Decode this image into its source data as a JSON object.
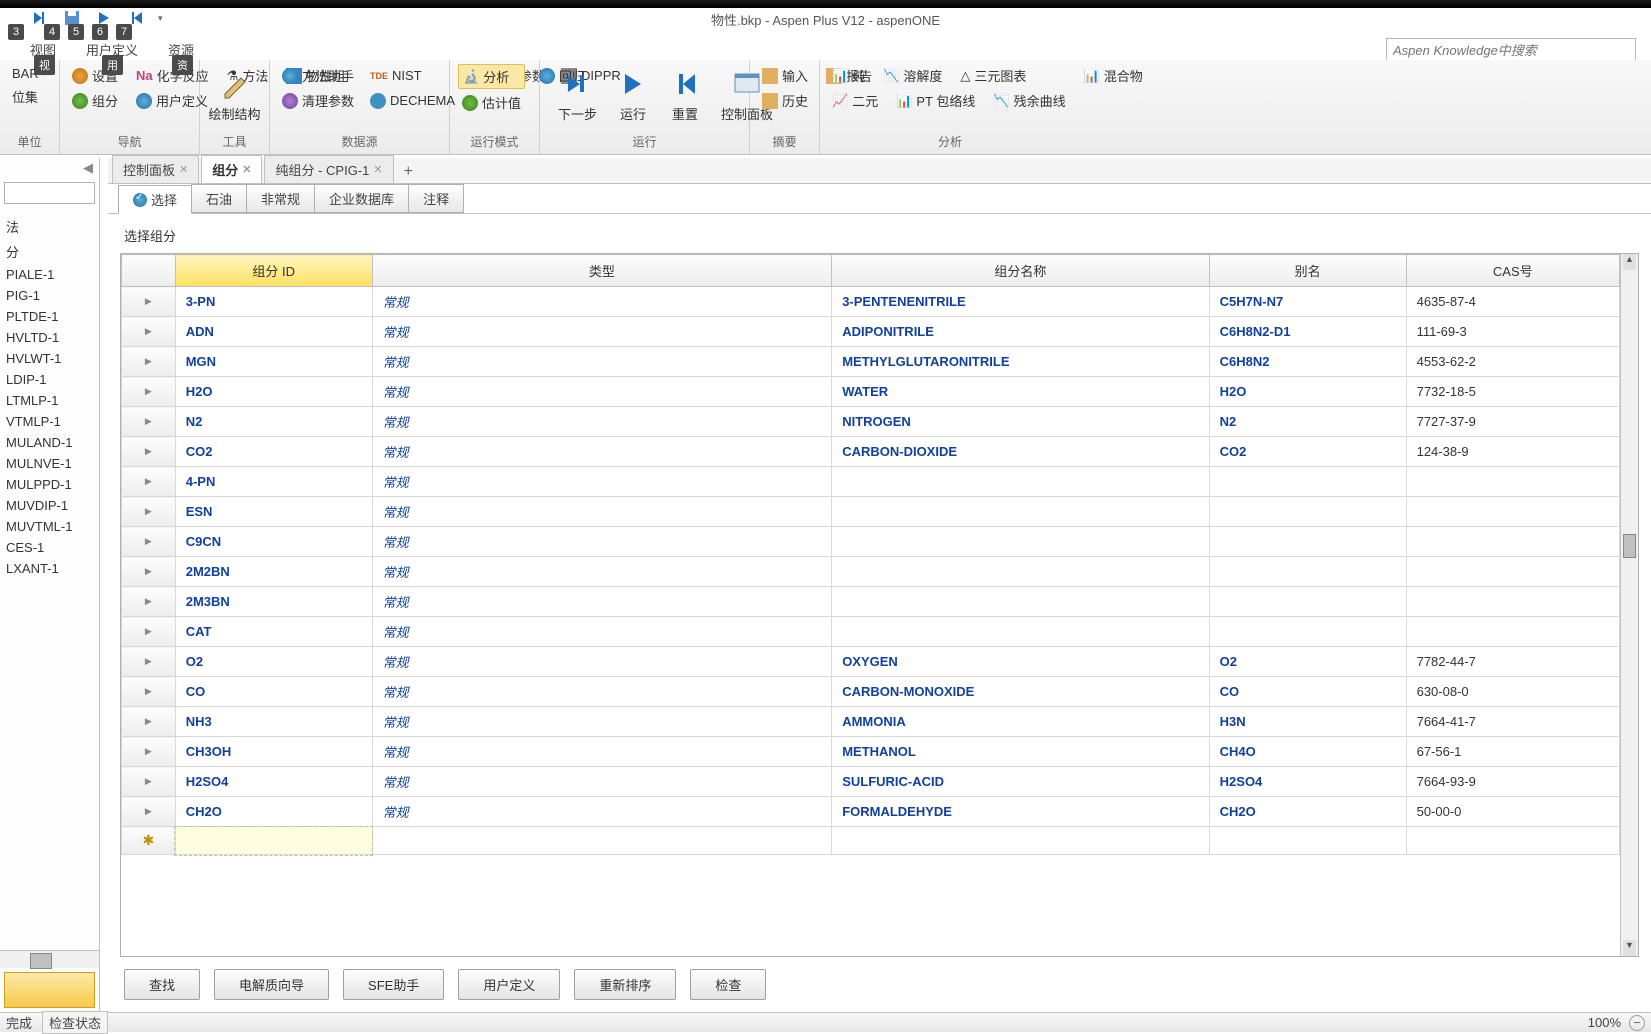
{
  "window": {
    "title": "物性.bkp - Aspen Plus V12 - aspenONE"
  },
  "keytips": [
    "3",
    "4",
    "5",
    "6",
    "7",
    "视",
    "用",
    "资"
  ],
  "menubar": {
    "items": [
      "视图",
      "用户定义",
      "资源"
    ]
  },
  "search": {
    "placeholder": "Aspen Knowledge中搜索"
  },
  "ribbon": {
    "groups": [
      {
        "label": "单位",
        "items": [
          {
            "text": "BAR"
          },
          {
            "text": "位集"
          }
        ]
      },
      {
        "label": "导航",
        "items": [
          {
            "text": "设置"
          },
          {
            "text": "化学反应"
          },
          {
            "text": "组分"
          },
          {
            "text": "用户定义"
          },
          {
            "text": "方法"
          },
          {
            "text": "物性组"
          }
        ]
      },
      {
        "label": "工具",
        "items": [
          {
            "text": "绘制结构",
            "big": true
          }
        ]
      },
      {
        "label": "数据源",
        "items": [
          {
            "text": "方法助手"
          },
          {
            "text": "NIST"
          },
          {
            "text": "清理参数"
          },
          {
            "text": "DECHEMA"
          },
          {
            "text": "检索参数"
          },
          {
            "text": "DIPPR"
          }
        ]
      },
      {
        "label": "运行模式",
        "items": [
          {
            "text": "分析",
            "active": true
          },
          {
            "text": "估计值"
          },
          {
            "text": "回归"
          }
        ]
      },
      {
        "label": "运行",
        "items": [
          {
            "text": "下一步",
            "big": true
          },
          {
            "text": "运行",
            "big": true
          },
          {
            "text": "重置",
            "big": true
          },
          {
            "text": "控制面板",
            "big": true
          }
        ]
      },
      {
        "label": "摘要",
        "items": [
          {
            "text": "输入"
          },
          {
            "text": "历史"
          },
          {
            "text": "报告"
          }
        ]
      },
      {
        "label": "分析",
        "items": [
          {
            "text": "纯"
          },
          {
            "text": "溶解度"
          },
          {
            "text": "三元图表"
          },
          {
            "text": "二元"
          },
          {
            "text": "PT 包络线"
          },
          {
            "text": "残余曲线"
          },
          {
            "text": "混合物"
          }
        ]
      }
    ]
  },
  "left_panel": {
    "tree_items": [
      "法",
      "分",
      "PIALE-1",
      "PIG-1",
      "PLTDE-1",
      "HVLTD-1",
      "HVLWT-1",
      "LDIP-1",
      "LTMLP-1",
      "VTMLP-1",
      "MULAND-1",
      "MULNVE-1",
      "MULPPD-1",
      "MUVDIP-1",
      "MUVTML-1",
      "CES-1",
      "LXANT-1"
    ]
  },
  "doc_tabs": {
    "items": [
      {
        "label": "控制面板",
        "closable": true
      },
      {
        "label": "组分",
        "active": true,
        "closable": true
      },
      {
        "label": "纯组分 - CPIG-1",
        "closable": true
      }
    ],
    "add": "+"
  },
  "inner_tabs": {
    "items": [
      {
        "label": "选择",
        "checked": true,
        "active": true
      },
      {
        "label": "石油"
      },
      {
        "label": "非常规"
      },
      {
        "label": "企业数据库"
      },
      {
        "label": "注释"
      }
    ]
  },
  "section": {
    "label": "选择组分"
  },
  "table": {
    "headers": [
      "组分 ID",
      "类型",
      "组分名称",
      "别名",
      "CAS号"
    ],
    "rows": [
      {
        "id": "3-PN",
        "type": "常规",
        "name": "3-PENTENENITRILE",
        "alias": "C5H7N-N7",
        "cas": "4635-87-4"
      },
      {
        "id": "ADN",
        "type": "常规",
        "name": "ADIPONITRILE",
        "alias": "C6H8N2-D1",
        "cas": "111-69-3"
      },
      {
        "id": "MGN",
        "type": "常规",
        "name": "METHYLGLUTARONITRILE",
        "alias": "C6H8N2",
        "cas": "4553-62-2"
      },
      {
        "id": "H2O",
        "type": "常规",
        "name": "WATER",
        "alias": "H2O",
        "cas": "7732-18-5"
      },
      {
        "id": "N2",
        "type": "常规",
        "name": "NITROGEN",
        "alias": "N2",
        "cas": "7727-37-9"
      },
      {
        "id": "CO2",
        "type": "常规",
        "name": "CARBON-DIOXIDE",
        "alias": "CO2",
        "cas": "124-38-9"
      },
      {
        "id": "4-PN",
        "type": "常规",
        "name": "",
        "alias": "",
        "cas": ""
      },
      {
        "id": "ESN",
        "type": "常规",
        "name": "",
        "alias": "",
        "cas": ""
      },
      {
        "id": "C9CN",
        "type": "常规",
        "name": "",
        "alias": "",
        "cas": ""
      },
      {
        "id": "2M2BN",
        "type": "常规",
        "name": "",
        "alias": "",
        "cas": ""
      },
      {
        "id": "2M3BN",
        "type": "常规",
        "name": "",
        "alias": "",
        "cas": ""
      },
      {
        "id": "CAT",
        "type": "常规",
        "name": "",
        "alias": "",
        "cas": ""
      },
      {
        "id": "O2",
        "type": "常规",
        "name": "OXYGEN",
        "alias": "O2",
        "cas": "7782-44-7"
      },
      {
        "id": "CO",
        "type": "常规",
        "name": "CARBON-MONOXIDE",
        "alias": "CO",
        "cas": "630-08-0"
      },
      {
        "id": "NH3",
        "type": "常规",
        "name": "AMMONIA",
        "alias": "H3N",
        "cas": "7664-41-7"
      },
      {
        "id": "CH3OH",
        "type": "常规",
        "name": "METHANOL",
        "alias": "CH4O",
        "cas": "67-56-1"
      },
      {
        "id": "H2SO4",
        "type": "常规",
        "name": "SULFURIC-ACID",
        "alias": "H2SO4",
        "cas": "7664-93-9"
      },
      {
        "id": "CH2O",
        "type": "常规",
        "name": "FORMALDEHYDE",
        "alias": "CH2O",
        "cas": "50-00-0"
      }
    ],
    "newrow_marker": "✱"
  },
  "bottom_buttons": [
    "查找",
    "电解质向导",
    "SFE助手",
    "用户定义",
    "重新排序",
    "检查"
  ],
  "status": {
    "left1": "完成",
    "left2": "检查状态",
    "zoom": "100%"
  }
}
